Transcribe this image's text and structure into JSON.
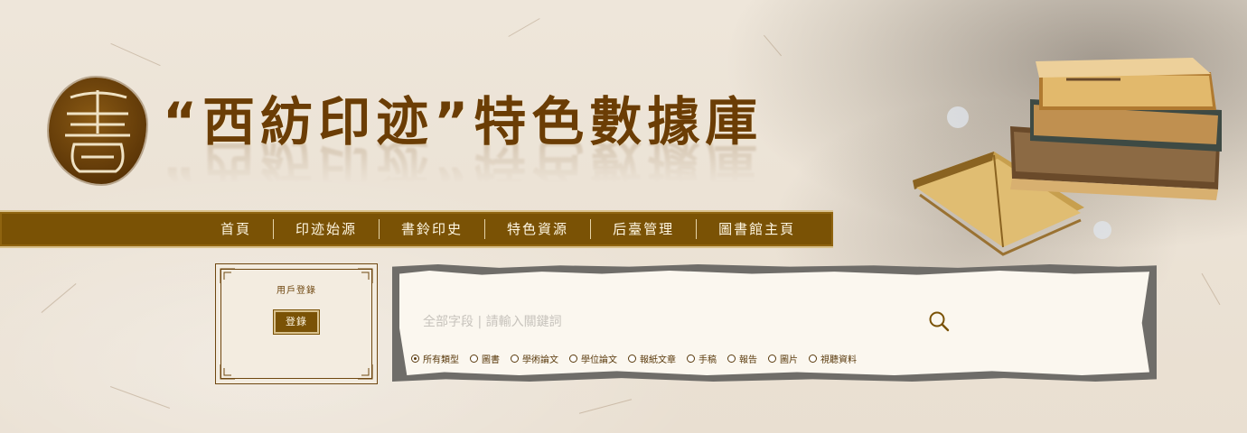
{
  "header": {
    "logo_char": "書",
    "title": "“西紡印迹”特色數據庫"
  },
  "nav": {
    "items": [
      "首頁",
      "印迹始源",
      "書鈴印史",
      "特色資源",
      "后臺管理",
      "圖書館主頁"
    ]
  },
  "login": {
    "title": "用戶登錄",
    "button": "登錄"
  },
  "search": {
    "placeholder": "全部字段 | 請輸入關鍵詞",
    "value": "",
    "types": [
      {
        "label": "所有類型",
        "selected": true
      },
      {
        "label": "圖書",
        "selected": false
      },
      {
        "label": "學術論文",
        "selected": false
      },
      {
        "label": "學位論文",
        "selected": false
      },
      {
        "label": "報紙文章",
        "selected": false
      },
      {
        "label": "手稿",
        "selected": false
      },
      {
        "label": "報告",
        "selected": false
      },
      {
        "label": "圖片",
        "selected": false
      },
      {
        "label": "視聽資料",
        "selected": false
      }
    ]
  },
  "icons": {
    "search": "magnifier-icon",
    "seal": "seal-logo-icon",
    "books": "old-books-illustration"
  },
  "colors": {
    "brand_brown": "#7a5205",
    "title_brown": "#6b3d05",
    "paper": "#ece3d6"
  }
}
